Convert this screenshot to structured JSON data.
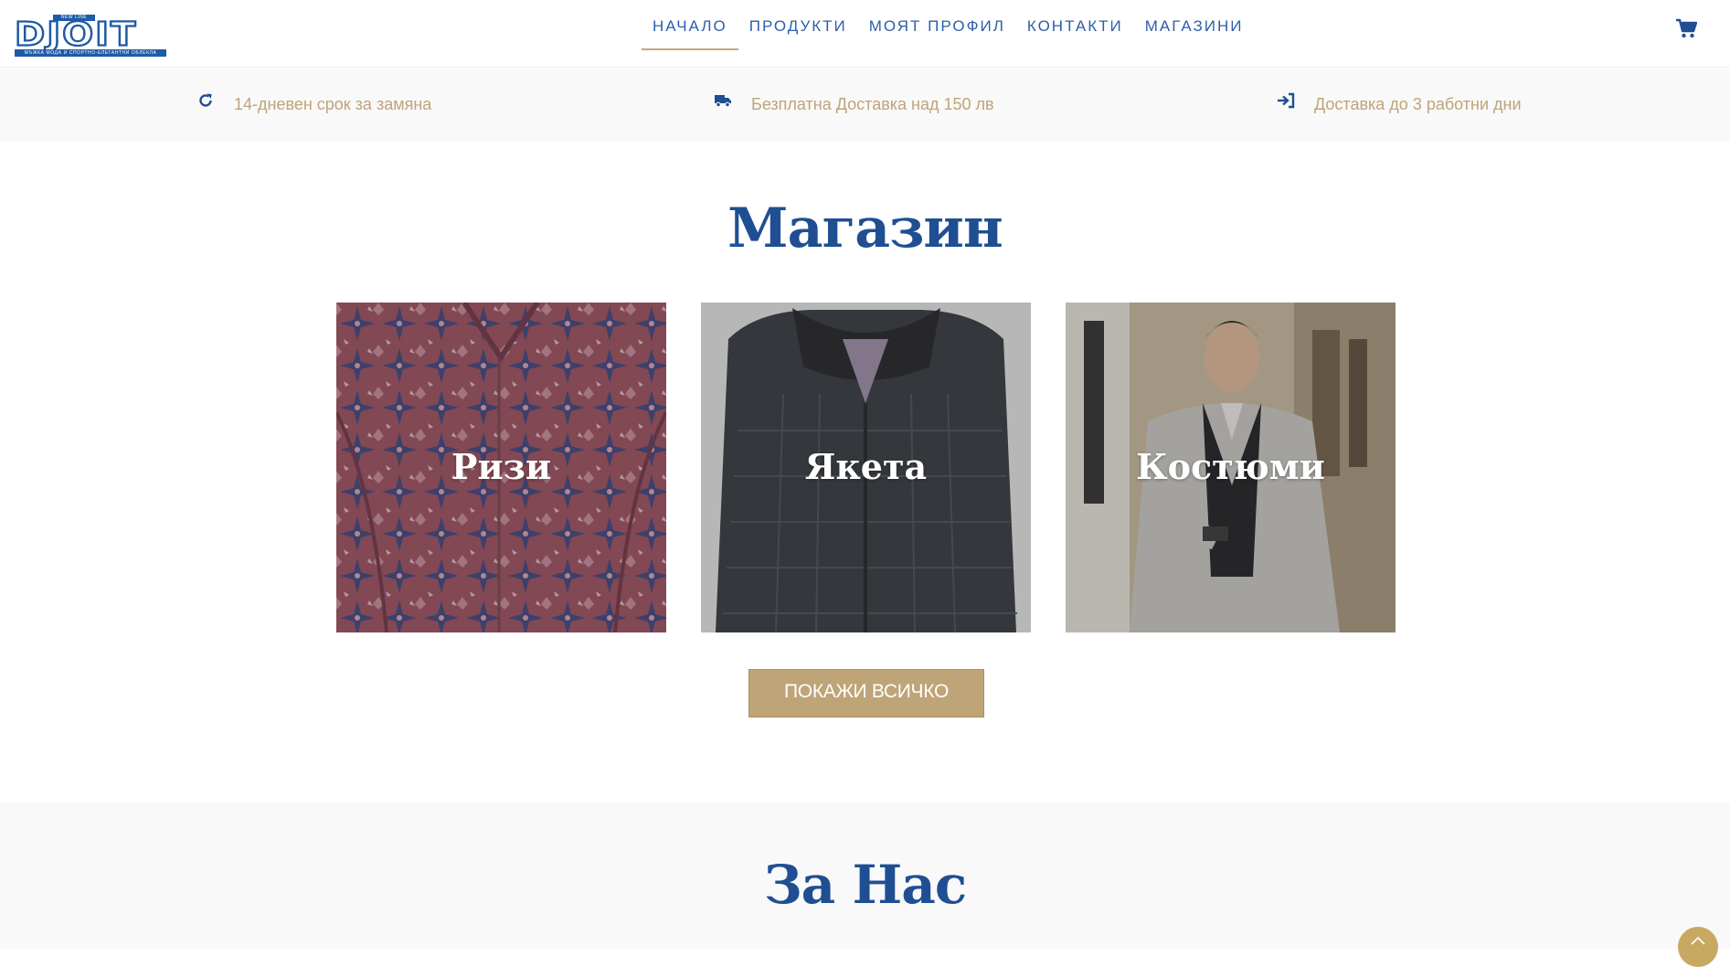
{
  "brand": {
    "logo_tag": "NEW LINE",
    "logo_text": "DJOIT",
    "logo_subtitle": "МЪЖКА МОДА И СПОРТНО-ЕЛЕГАНТНИ ОБЛЕКЛА",
    "primary_color": "#1f5aa6"
  },
  "nav": {
    "items": [
      {
        "label": "НАЧАЛО",
        "active": true
      },
      {
        "label": "ПРОДУКТИ",
        "active": false
      },
      {
        "label": "МОЯТ ПРОФИЛ",
        "active": false
      },
      {
        "label": "КОНТАКТИ",
        "active": false
      },
      {
        "label": "МАГАЗИНИ",
        "active": false
      }
    ],
    "cart_icon": "shopping-cart-icon",
    "accent_color": "#c4a97a"
  },
  "features": [
    {
      "icon": "refresh-icon",
      "text": "14-дневен срок за замяна"
    },
    {
      "icon": "truck-icon",
      "text": "Безплатна Доставка над 150 лв"
    },
    {
      "icon": "sign-in-icon",
      "text": "Доставка до 3 работни дни"
    }
  ],
  "shop": {
    "title": "Магазин",
    "categories": [
      {
        "label": "Ризи",
        "image": "patterned-shirt"
      },
      {
        "label": "Якета",
        "image": "quilted-jacket"
      },
      {
        "label": "Костюми",
        "image": "man-in-suit"
      }
    ],
    "show_all_label": "ПОКАЖИ ВСИЧКО",
    "button_color": "#bfa478"
  },
  "about": {
    "title": "За Нас"
  },
  "scroll_top_icon": "chevron-up-icon"
}
